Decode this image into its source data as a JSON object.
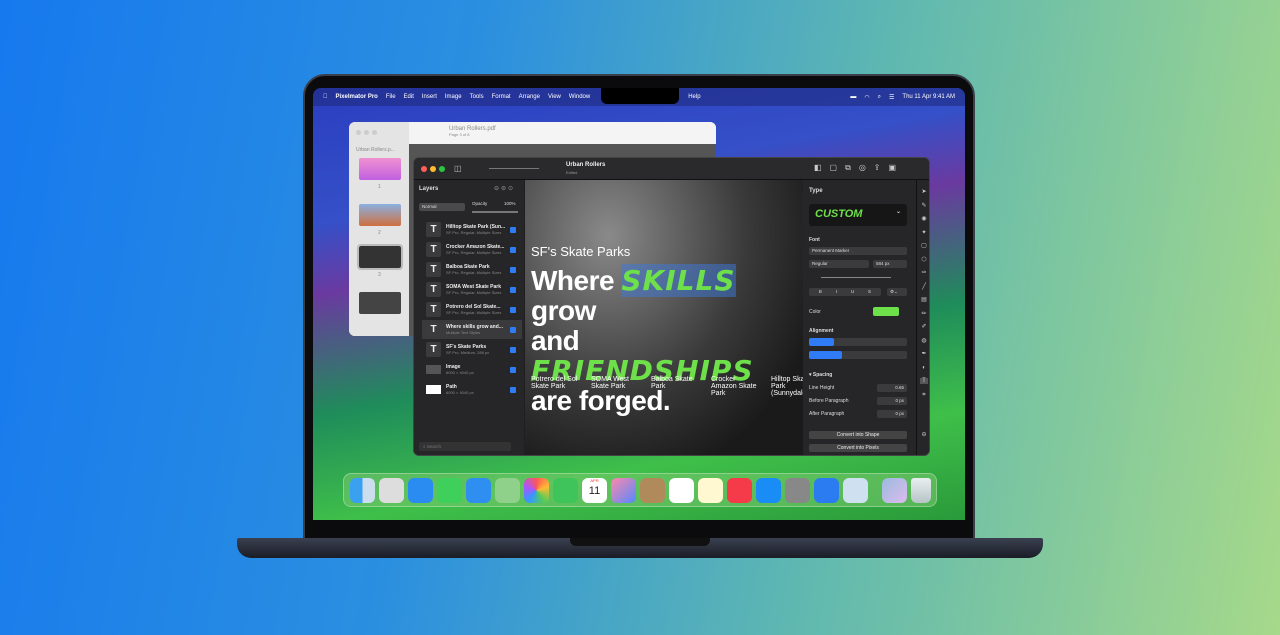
{
  "menubar": {
    "app": "Pixelmator Pro",
    "items": [
      "File",
      "Edit",
      "Insert",
      "Image",
      "Tools",
      "Format",
      "Arrange",
      "View",
      "Window",
      "Help"
    ],
    "clock": "Thu 11 Apr 9:41 AM"
  },
  "preview": {
    "title": "Urban Rollers.pdf",
    "subtitle": "Page 3 of 8",
    "sidebar_title": "Urban Rollers.p...",
    "pages": [
      "1",
      "2",
      "3",
      "4"
    ]
  },
  "pixelmator": {
    "title": "Urban Rollers",
    "subtitle": "Edited",
    "layers": {
      "title": "Layers",
      "blend": "Normal",
      "opacity_label": "Opacity",
      "opacity": "100%",
      "search_placeholder": "Search",
      "items": [
        {
          "name": "Hilltop Skate Park (Sun...",
          "sub": "SF Pro, Regular, Multiple Sizes",
          "type": "text"
        },
        {
          "name": "Crocker Amazon Skate...",
          "sub": "SF Pro, Regular, Multiple Sizes",
          "type": "text"
        },
        {
          "name": "Balboa Skate Park",
          "sub": "SF Pro, Regular, Multiple Sizes",
          "type": "text"
        },
        {
          "name": "SOMA West Skate Park",
          "sub": "SF Pro, Regular, Multiple Sizes",
          "type": "text"
        },
        {
          "name": "Potrero del Sol Skate...",
          "sub": "SF Pro, Regular, Multiple Sizes",
          "type": "text"
        },
        {
          "name": "Where skills grow and...",
          "sub": "Multiple Text Styles",
          "type": "text",
          "selected": true
        },
        {
          "name": "SF's Skate Parks",
          "sub": "SF Pro, Medium, 288 px",
          "type": "text"
        },
        {
          "name": "Image",
          "sub": "6000 × 4040 px",
          "type": "image"
        },
        {
          "name": "Path",
          "sub": "6000 × 4040 px",
          "type": "path"
        }
      ]
    },
    "canvas": {
      "heading": "SF's Skate Parks",
      "line1a": "Where ",
      "line1b": "SKILLS",
      "line1c": " grow",
      "line2a": "and ",
      "line2b": "FRIENDSHIPS",
      "line3": "are forged.",
      "parks": [
        "Potrero del Sol Skate Park",
        "SOMA West Skate Park",
        "Balboa Skate Park",
        "Crocker Amazon Skate Park",
        "Hilltop Skate Park (Sunnydale)"
      ]
    },
    "props": {
      "type_title": "Type",
      "style": "CUSTOM",
      "font_title": "Font",
      "font": "Permanent Marker",
      "weight": "Regular",
      "size": "584 px",
      "format": [
        "B",
        "I",
        "U",
        "S"
      ],
      "color_label": "Color",
      "color": "#6ee04a",
      "alignment_title": "Alignment",
      "spacing_title": "Spacing",
      "line_height_label": "Line Height",
      "line_height": "0.65",
      "before_label": "Before Paragraph",
      "before": "0 px",
      "after_label": "After Paragraph",
      "after": "0 px",
      "convert_shape": "Convert into Shape",
      "convert_pixels": "Convert into Pixels"
    }
  },
  "dock": {
    "apps": [
      "finder",
      "launchpad",
      "safari",
      "messages",
      "mail",
      "maps",
      "photos",
      "facetime",
      "calendar",
      "pixelmator",
      "contacts",
      "reminders",
      "notes",
      "music",
      "app-store",
      "system-settings",
      "keynote",
      "preview"
    ],
    "calendar_month": "APR",
    "calendar_day": "11",
    "extras": [
      "downloads",
      "trash"
    ]
  }
}
